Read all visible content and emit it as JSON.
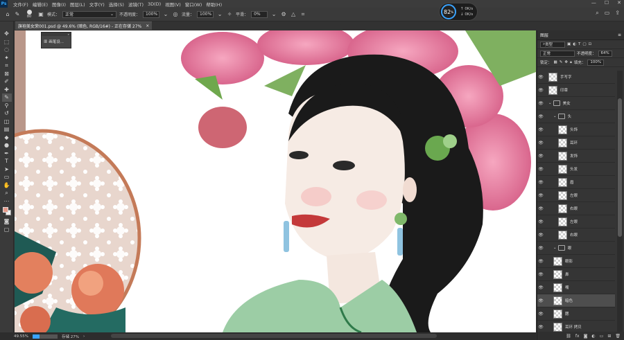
{
  "app": {
    "logo": "Ps"
  },
  "menubar": {
    "items": [
      "文件(F)",
      "编辑(E)",
      "图像(I)",
      "图层(L)",
      "文字(Y)",
      "选择(S)",
      "滤镜(T)",
      "3D(D)",
      "视图(V)",
      "窗口(W)",
      "帮助(H)"
    ]
  },
  "window_controls": {
    "minimize": "—",
    "maximize": "☐",
    "close": "✕"
  },
  "options": {
    "brush_size": "80",
    "mode_label": "模式：",
    "mode_value": "正常",
    "opacity_label": "不透明度：",
    "opacity_value": "100%",
    "flow_label": "流量：",
    "flow_value": "100%",
    "smooth_label": "平滑：",
    "smooth_value": "0%"
  },
  "performance": {
    "percent": "82",
    "unit": "%",
    "up_rate": "0K/s",
    "down_rate": "0K/s"
  },
  "doc_tab": {
    "title": "旗袍美女荣001.psd @ 49.6% (暗色, RGB/16#) - 正在存储 27%",
    "close": "×"
  },
  "brush_panel": {
    "label": "画笔设..."
  },
  "layers_panel": {
    "tab": "图层",
    "kind_label": "类型",
    "blend_mode": "正常",
    "opacity_label": "不透明度：",
    "opacity_value": "64%",
    "lock_label": "锁定：",
    "fill_label": "填充：",
    "fill_value": "100%",
    "layers": [
      {
        "name": "手写字",
        "type": "layer"
      },
      {
        "name": "印章",
        "type": "layer"
      },
      {
        "name": "美女",
        "type": "group"
      },
      {
        "name": "头",
        "type": "group"
      },
      {
        "name": "头饰",
        "type": "layer"
      },
      {
        "name": "耳环",
        "type": "layer"
      },
      {
        "name": "发饰",
        "type": "layer"
      },
      {
        "name": "头发",
        "type": "layer"
      },
      {
        "name": "眉",
        "type": "layer"
      },
      {
        "name": "左眼",
        "type": "layer"
      },
      {
        "name": "右眼",
        "type": "layer"
      },
      {
        "name": "左眼",
        "type": "layer"
      },
      {
        "name": "右眼",
        "type": "layer"
      },
      {
        "name": "眼",
        "type": "group"
      },
      {
        "name": "眼影",
        "type": "layer"
      },
      {
        "name": "鼻",
        "type": "layer"
      },
      {
        "name": "嘴",
        "type": "layer"
      },
      {
        "name": "暗色",
        "type": "layer"
      },
      {
        "name": "腮",
        "type": "layer"
      },
      {
        "name": "耳环 拷贝",
        "type": "layer"
      }
    ]
  },
  "status": {
    "zoom": "49.55%",
    "save_label": "存储 27%",
    "save_progress": 0.27
  },
  "colors": {
    "foreground": "#e79a8a",
    "background": "#f0f0f0",
    "accent": "#3aa3ff"
  }
}
